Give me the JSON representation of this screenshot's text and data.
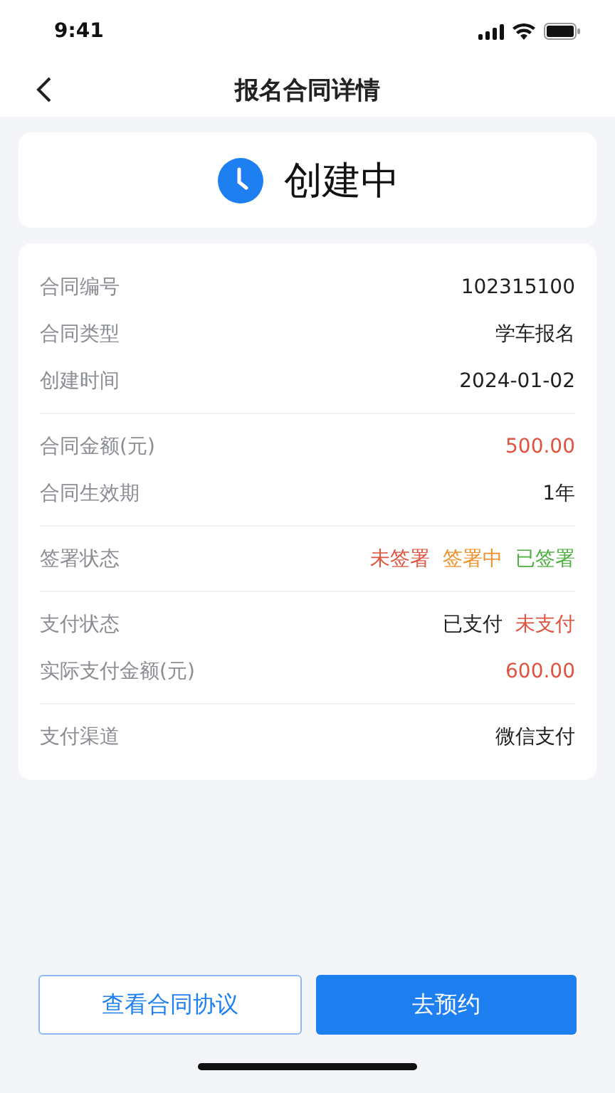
{
  "status_bar": {
    "time": "9:41"
  },
  "nav": {
    "title": "报名合同详情"
  },
  "status": {
    "label": "创建中"
  },
  "sections": [
    {
      "rows": [
        {
          "label": "合同编号",
          "values": [
            {
              "text": "102315100",
              "color": "#1f1f1f"
            }
          ]
        },
        {
          "label": "合同类型",
          "values": [
            {
              "text": "学车报名",
              "color": "#1f1f1f"
            }
          ]
        },
        {
          "label": "创建时间",
          "values": [
            {
              "text": "2024-01-02",
              "color": "#1f1f1f"
            }
          ]
        }
      ]
    },
    {
      "rows": [
        {
          "label": "合同金额(元)",
          "values": [
            {
              "text": "500.00",
              "color": "#e0533f"
            }
          ]
        },
        {
          "label": "合同生效期",
          "values": [
            {
              "text": "1年",
              "color": "#1f1f1f"
            }
          ]
        }
      ]
    },
    {
      "rows": [
        {
          "label": "签署状态",
          "values": [
            {
              "text": "未签署",
              "color": "#e0533f"
            },
            {
              "text": "签署中",
              "color": "#f0902a"
            },
            {
              "text": "已签署",
              "color": "#4caf3f"
            }
          ]
        }
      ]
    },
    {
      "rows": [
        {
          "label": "支付状态",
          "values": [
            {
              "text": "已支付",
              "color": "#1f1f1f"
            },
            {
              "text": "未支付",
              "color": "#e0533f"
            }
          ]
        },
        {
          "label": "实际支付金额(元)",
          "values": [
            {
              "text": "600.00",
              "color": "#e0533f"
            }
          ]
        }
      ]
    },
    {
      "rows": [
        {
          "label": "支付渠道",
          "values": [
            {
              "text": "微信支付",
              "color": "#1f1f1f"
            }
          ]
        }
      ]
    }
  ],
  "buttons": [
    {
      "label": "查看合同协议",
      "kind": "outline"
    },
    {
      "label": "去预约",
      "kind": "primary"
    }
  ]
}
